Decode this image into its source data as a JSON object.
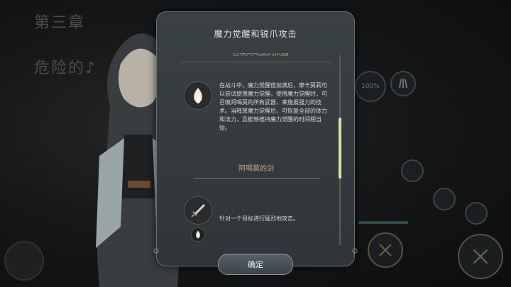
{
  "background": {
    "chapter_title": "第三章",
    "chapter_subtitle": "危险的♪",
    "hud_percent": "100%"
  },
  "dialog": {
    "title": "魔力觉醒和锐爪攻击",
    "confirm_label": "确定",
    "sections": [
      {
        "heading": "召唤阿喝莫的武器",
        "icon": "flame-crystal-icon",
        "description": "在战斗中，魔力觉醒值加满后，摩卡莫莉可以尝试使用魔力觉醒。使用魔力觉醒时，可召唤阿喝莫的所有武器，来施展强力的技术。当释放魔力觉醒后，可恢复全部的体力和法力，且能够维持魔力觉醒的时间相当短。"
      },
      {
        "heading": "阿喝莫的剑",
        "icon": "sword-icon",
        "description": "针对一个目标进行猛烈地攻击。",
        "sub_icon": "flame-crystal-icon"
      }
    ]
  },
  "colors": {
    "accent": "#d8e3a6",
    "heading": "#c2a98a",
    "dialog_bg": "#343b3e"
  }
}
